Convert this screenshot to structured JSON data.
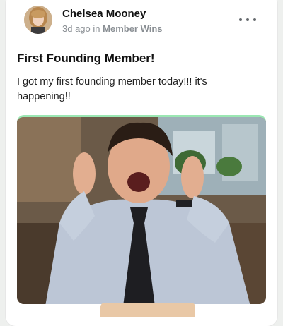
{
  "post": {
    "author": "Chelsea Mooney",
    "time_ago": "3d ago",
    "in_label": "in",
    "space": "Member Wins",
    "title": "First Founding Member!",
    "body": "I got my first founding member today!!! it's happening!!"
  },
  "icons": {
    "more": "more-horizontal-icon"
  },
  "colors": {
    "accent_border": "#9be7b3",
    "meta_text": "#8a8f94"
  }
}
